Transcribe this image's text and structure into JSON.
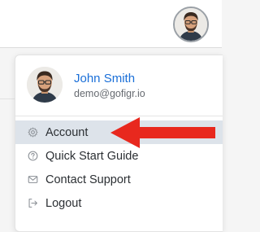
{
  "header": {
    "avatar_icon": "user-avatar-icon"
  },
  "profile": {
    "name": "John Smith",
    "email": "demo@gofigr.io",
    "name_color": "#1a6fd8"
  },
  "menu": {
    "items": [
      {
        "label": "Account",
        "icon": "gear-icon",
        "active": true
      },
      {
        "label": "Quick Start Guide",
        "icon": "help-circle-icon",
        "active": false
      },
      {
        "label": "Contact Support",
        "icon": "mail-icon",
        "active": false
      },
      {
        "label": "Logout",
        "icon": "logout-icon",
        "active": false
      }
    ]
  },
  "annotation": {
    "arrow_color": "#e8281e",
    "points_to": "Account"
  }
}
